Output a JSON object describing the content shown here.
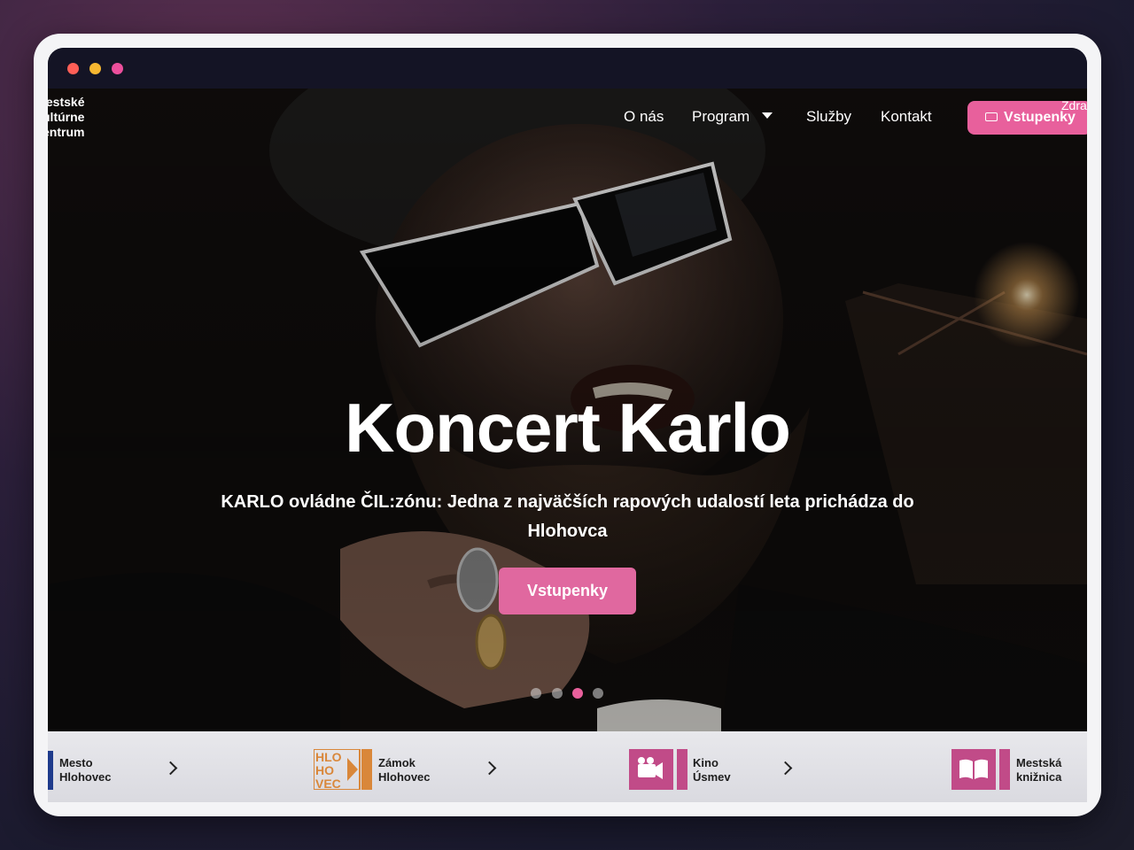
{
  "window": {
    "controls": [
      "close",
      "minimize",
      "maximize"
    ]
  },
  "site": {
    "logo_text": "Mestské\nkultúrne\ncentrum",
    "logo_visible": "lestské\nultúrne\nentrum"
  },
  "nav": {
    "items": [
      {
        "label": "O nás"
      },
      {
        "label": "Program"
      },
      {
        "label": "Služby"
      },
      {
        "label": "Kontakt"
      }
    ],
    "tickets_label": "Vstupenky",
    "cut_label": "Zdra"
  },
  "hero": {
    "title": "Koncert Karlo",
    "subtitle": "KARLO ovládne ČIL:zónu: Jedna z najväčších rapových udalostí leta prichádza do Hlohovca",
    "button_label": "Vstupenky",
    "slides_total": 4,
    "active_slide": 3
  },
  "partners": [
    {
      "name": "Mesto\nHlohovec",
      "icon": "city-icon"
    },
    {
      "name": "Zámok\nHlohovec",
      "icon": "hlohovec-logo-icon",
      "logo_text": "HLO\nHO\nVEC"
    },
    {
      "name": "Kino\nÚsmev",
      "icon": "video-camera-icon"
    },
    {
      "name": "Mestská\nknižnica",
      "icon": "book-icon"
    }
  ],
  "colors": {
    "accent": "#e8609c",
    "dark": "#141425",
    "zamok_orange": "#d9873a",
    "city_blue": "#1f3b8c"
  }
}
